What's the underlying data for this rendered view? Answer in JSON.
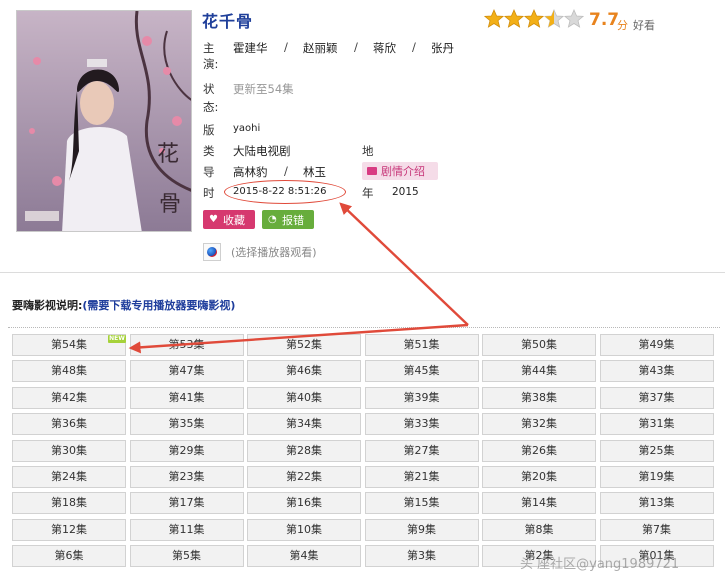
{
  "title": "花千骨",
  "rating": {
    "score": "7.7",
    "unit": "分",
    "tag": "好看",
    "stars": 3.5
  },
  "details": {
    "cast_label": [
      "主",
      "演:"
    ],
    "cast": [
      "霍建华",
      "赵丽颖",
      "蒋欣",
      "张丹"
    ],
    "cast_sep": "/",
    "status_label": [
      "状",
      "态:"
    ],
    "status": "更新至54集",
    "version_label": "版",
    "version": "yaohi",
    "type_label": "类",
    "type": "大陆电视剧",
    "region_label": "地",
    "director_label": "导",
    "directors": [
      "高林豹",
      "林玉"
    ],
    "plot_button": "剧情介绍",
    "time_label": "时",
    "time": "2015-8-22 8:51:26",
    "year_label": "年",
    "year": "2015"
  },
  "actions": {
    "favorite": "收藏",
    "report": "报错",
    "player_hint": "(选择播放器观看)"
  },
  "instructions": {
    "prefix": "要嗨影视说明:",
    "link": "(需要下载专用播放器要嗨影视)"
  },
  "new_badge": "NEW",
  "episodes": [
    "第54集",
    "第53集",
    "第52集",
    "第51集",
    "第50集",
    "第49集",
    "第48集",
    "第47集",
    "第46集",
    "第45集",
    "第44集",
    "第43集",
    "第42集",
    "第41集",
    "第40集",
    "第39集",
    "第38集",
    "第37集",
    "第36集",
    "第35集",
    "第34集",
    "第33集",
    "第32集",
    "第31集",
    "第30集",
    "第29集",
    "第28集",
    "第27集",
    "第26集",
    "第25集",
    "第24集",
    "第23集",
    "第22集",
    "第21集",
    "第20集",
    "第19集",
    "第18集",
    "第17集",
    "第16集",
    "第15集",
    "第14集",
    "第13集",
    "第12集",
    "第11集",
    "第10集",
    "第9集",
    "第8集",
    "第7集",
    "第6集",
    "第5集",
    "第4集",
    "第3集",
    "第2集",
    "第01集"
  ],
  "colors": {
    "title": "#1f3f9a",
    "score": "#e8831d",
    "annotation": "#e04a3a",
    "favorite": "#d6386f",
    "report": "#67ad3c"
  },
  "watermark": "头 座社区@yang1989721"
}
